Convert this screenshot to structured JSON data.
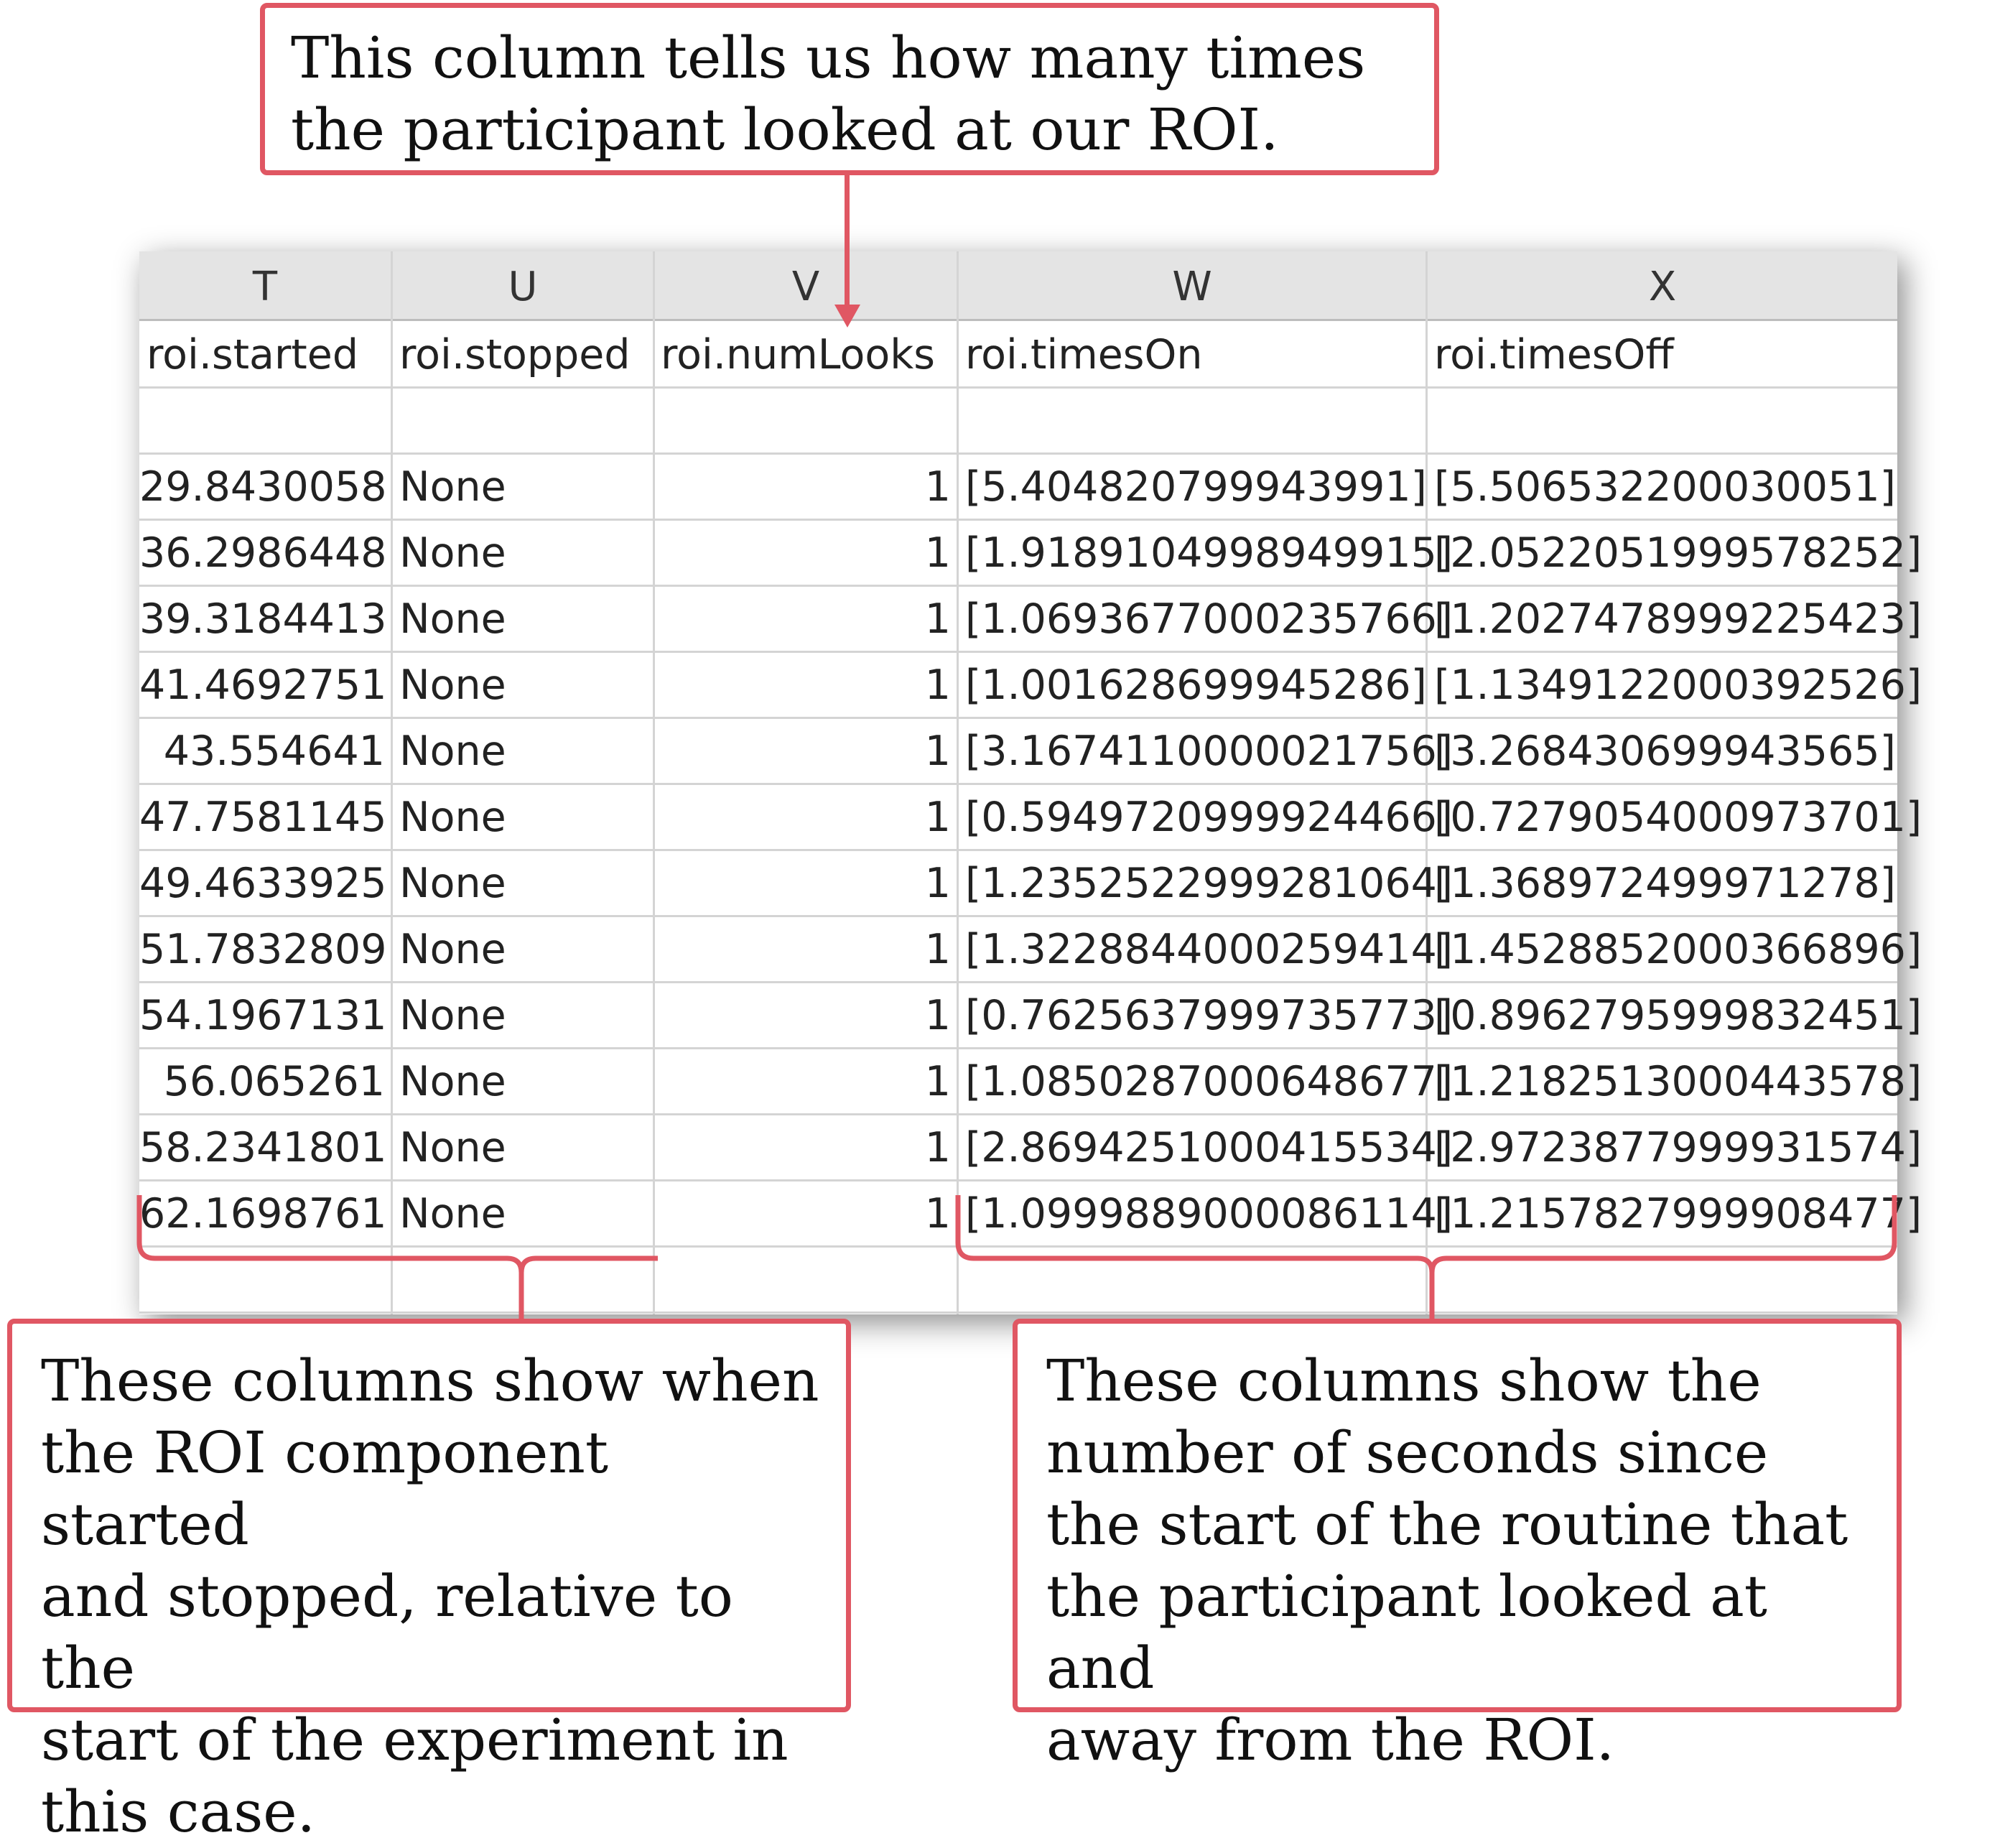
{
  "spreadsheet": {
    "column_letters": [
      "T",
      "U",
      "V",
      "W",
      "X"
    ],
    "field_headers": [
      "roi.started",
      "roi.stopped",
      "roi.numLooks",
      "roi.timesOn",
      "roi.timesOff"
    ],
    "rows": [
      [
        "29.8430058",
        "None",
        "1",
        "[5.404820799943991]",
        "[5.506532200030051]"
      ],
      [
        "36.2986448",
        "None",
        "1",
        "[1.9189104998949915]",
        "[2.0522051999578252]"
      ],
      [
        "39.3184413",
        "None",
        "1",
        "[1.0693677000235766]",
        "[1.2027478999225423]"
      ],
      [
        "41.4692751",
        "None",
        "1",
        "[1.001628699945286]",
        "[1.1349122000392526]"
      ],
      [
        "43.554641",
        "None",
        "1",
        "[3.1674110000021756]",
        "[3.268430699943565]"
      ],
      [
        "47.7581145",
        "None",
        "1",
        "[0.5949720999924466]",
        "[0.7279054000973701]"
      ],
      [
        "49.4633925",
        "None",
        "1",
        "[1.2352522999281064]",
        "[1.368972499971278]"
      ],
      [
        "51.7832809",
        "None",
        "1",
        "[1.3228844000259414]",
        "[1.4528852000366896]"
      ],
      [
        "54.1967131",
        "None",
        "1",
        "[0.7625637999735773]",
        "[0.8962795999832451]"
      ],
      [
        "56.065261",
        "None",
        "1",
        "[1.0850287000648677]",
        "[1.2182513000443578]"
      ],
      [
        "58.2341801",
        "None",
        "1",
        "[2.8694251000415534]",
        "[2.9723877999931574]"
      ],
      [
        "62.1698761",
        "None",
        "1",
        "[1.0999889000086114]",
        "[1.2157827999908477]"
      ]
    ]
  },
  "callouts": {
    "top": "This column tells us how many times\nthe participant looked at our ROI.",
    "bottom_left": "These columns show when\nthe ROI component started\nand stopped, relative to the\nstart of the experiment in\nthis case.",
    "bottom_right": "These columns show the\nnumber of seconds since\nthe start of the routine that\nthe participant looked at and\naway from the ROI."
  },
  "colors": {
    "callout_border": "#e05763",
    "header_bg": "#e4e4e4",
    "grid_line": "#d4d4d4"
  }
}
